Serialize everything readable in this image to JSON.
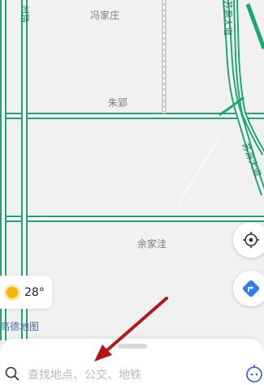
{
  "map": {
    "places": [
      {
        "name": "冯家庄"
      },
      {
        "name": "朱郢"
      },
      {
        "name": "余家洼"
      }
    ],
    "roads": [
      {
        "name": "州路"
      },
      {
        "name": "苏滁大道"
      },
      {
        "name": "苏滁大道"
      }
    ],
    "colors": {
      "background": "#f1f1f1",
      "road": "#1aa86e",
      "road_fill": "#ffffff"
    }
  },
  "weather": {
    "temperature": "28°",
    "icon": "sun-icon"
  },
  "brand": {
    "text": "高德地图"
  },
  "controls": {
    "locate_icon": "locate-icon",
    "navigate_icon": "navigate-icon"
  },
  "search": {
    "placeholder": "查找地点、公交、地铁",
    "icon": "search-icon"
  },
  "annotation": {
    "color": "#b3171b"
  }
}
